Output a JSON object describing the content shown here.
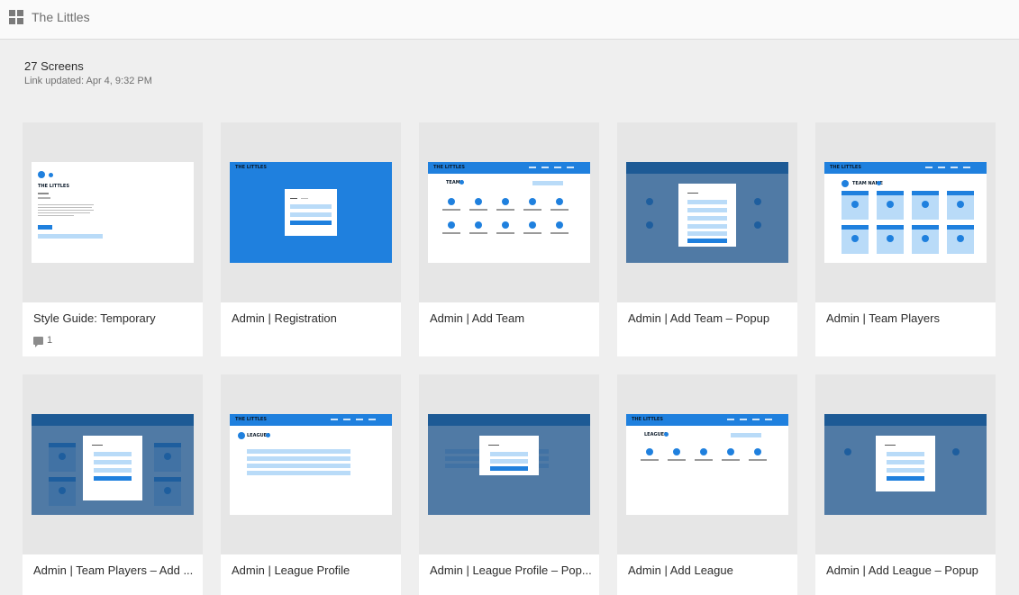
{
  "header": {
    "project_title": "The Littles"
  },
  "summary": {
    "screens_count": "27 Screens",
    "link_updated": "Link updated: Apr 4, 9:32 PM"
  },
  "cards": [
    {
      "title": "Style Guide: Temporary",
      "comments": "1"
    },
    {
      "title": "Admin | Registration"
    },
    {
      "title": "Admin | Add Team"
    },
    {
      "title": "Admin | Add Team – Popup"
    },
    {
      "title": "Admin | Team Players"
    },
    {
      "title": "Admin | Team Players – Add ..."
    },
    {
      "title": "Admin | League Profile"
    },
    {
      "title": "Admin | League Profile – Pop..."
    },
    {
      "title": "Admin | Add League"
    },
    {
      "title": "Admin | Add League – Popup"
    }
  ],
  "mockups": {
    "logo": "THE LITTLES",
    "teams_heading": "TEAMS",
    "team_name_heading": "TEAM NAME",
    "leagues_heading": "LEAGUES"
  },
  "colors": {
    "accent": "#1f80de",
    "page_bg": "#efefef",
    "card_bg": "#ffffff",
    "thumb_bg": "#e6e6e6"
  }
}
